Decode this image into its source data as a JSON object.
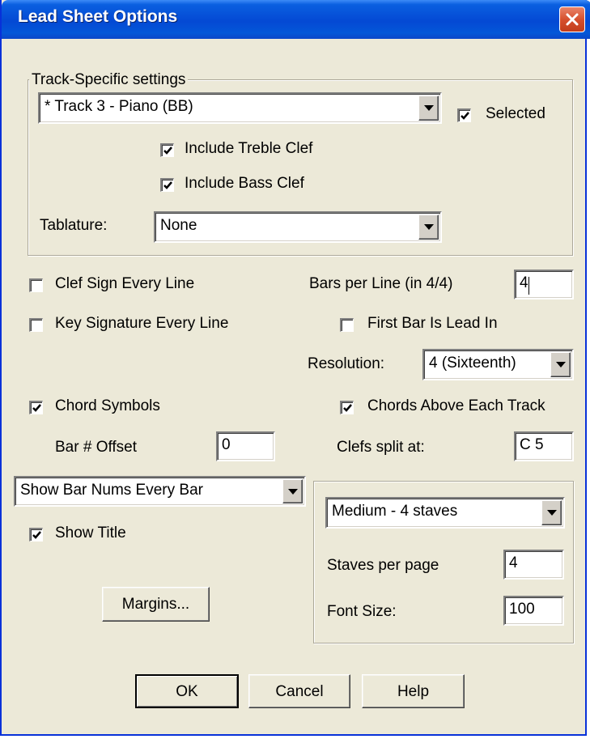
{
  "window": {
    "title": "Lead Sheet Options",
    "close_icon": "close-icon",
    "colors": {
      "titlebar": "#0449d4",
      "face": "#ece9d8",
      "close": "#d6502e"
    }
  },
  "track_group": {
    "legend": "Track-Specific settings",
    "track_select": {
      "value": "* Track 3 - Piano   (BB)"
    },
    "selected": {
      "label": "Selected",
      "checked": true
    },
    "include_treble": {
      "label": "Include Treble Clef",
      "checked": true
    },
    "include_bass": {
      "label": "Include Bass Clef",
      "checked": true
    },
    "tablature_label": "Tablature:",
    "tablature_select": {
      "value": "None"
    }
  },
  "clef_sign": {
    "label": "Clef Sign Every Line",
    "checked": false
  },
  "key_signature": {
    "label": "Key Signature Every Line",
    "checked": false
  },
  "bars_per_line": {
    "label": "Bars per Line (in 4/4)",
    "value": "4"
  },
  "first_bar_lead_in": {
    "label": "First Bar Is Lead In",
    "checked": false
  },
  "resolution": {
    "label": "Resolution:",
    "value": "4 (Sixteenth)"
  },
  "chord_symbols": {
    "label": "Chord Symbols",
    "checked": true
  },
  "chords_above": {
    "label": "Chords Above Each Track",
    "checked": true
  },
  "bar_offset": {
    "label": "Bar # Offset",
    "value": "0"
  },
  "clefs_split": {
    "label": "Clefs split at:",
    "value": "C 5"
  },
  "bar_nums_select": {
    "value": "Show Bar Nums Every Bar"
  },
  "show_title": {
    "label": "Show Title",
    "checked": true
  },
  "margins_button": {
    "label": "Margins..."
  },
  "page_group": {
    "staves_select": {
      "value": "Medium - 4 staves"
    },
    "staves_per_page": {
      "label": "Staves per page",
      "value": "4"
    },
    "font_size": {
      "label": "Font Size:",
      "value": "100"
    }
  },
  "buttons": {
    "ok": "OK",
    "cancel": "Cancel",
    "help": "Help"
  }
}
